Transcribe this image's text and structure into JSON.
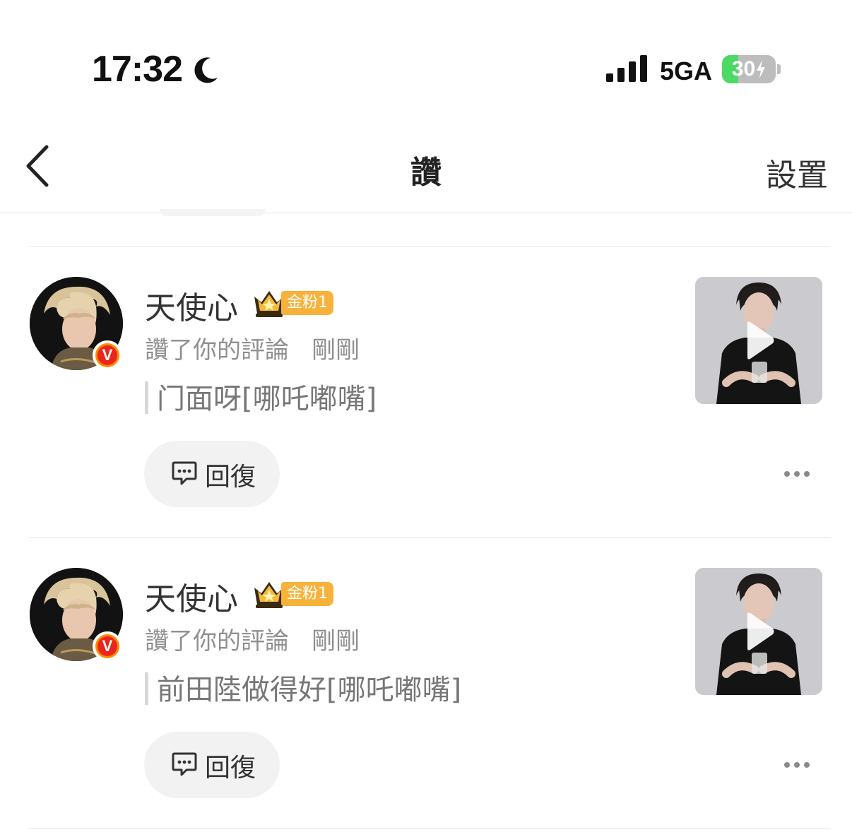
{
  "status_bar": {
    "time": "17:32",
    "network": "5GA",
    "battery": "30",
    "battery_level": 0.3,
    "icons": [
      "moon-icon",
      "cellular-signal-icon",
      "battery-charging-icon"
    ]
  },
  "nav": {
    "back_icon": "chevron-left-icon",
    "title": "讚",
    "settings_label": "設置"
  },
  "items": [
    {
      "user_name": "天使心",
      "fan_badge": "金粉1",
      "action": "讚了你的評論",
      "time": "剛剛",
      "quote": "门面呀[哪吒嘟嘴]",
      "reply_label": "回復",
      "icons": [
        "avatar",
        "verified-v-icon",
        "crown-icon",
        "comment-icon",
        "more-dots-icon",
        "play-icon"
      ]
    },
    {
      "user_name": "天使心",
      "fan_badge": "金粉1",
      "action": "讚了你的評論",
      "time": "剛剛",
      "quote": "前田陸做得好[哪吒嘟嘴]",
      "reply_label": "回復",
      "icons": [
        "avatar",
        "verified-v-icon",
        "crown-icon",
        "comment-icon",
        "more-dots-icon",
        "play-icon"
      ]
    }
  ],
  "colors": {
    "battery_green": "#4cd964",
    "fan_badge": "#f7b23b",
    "verified_ring": "#ff8a00",
    "verified_fill": "#e8261c",
    "secondary_text": "#909090"
  }
}
